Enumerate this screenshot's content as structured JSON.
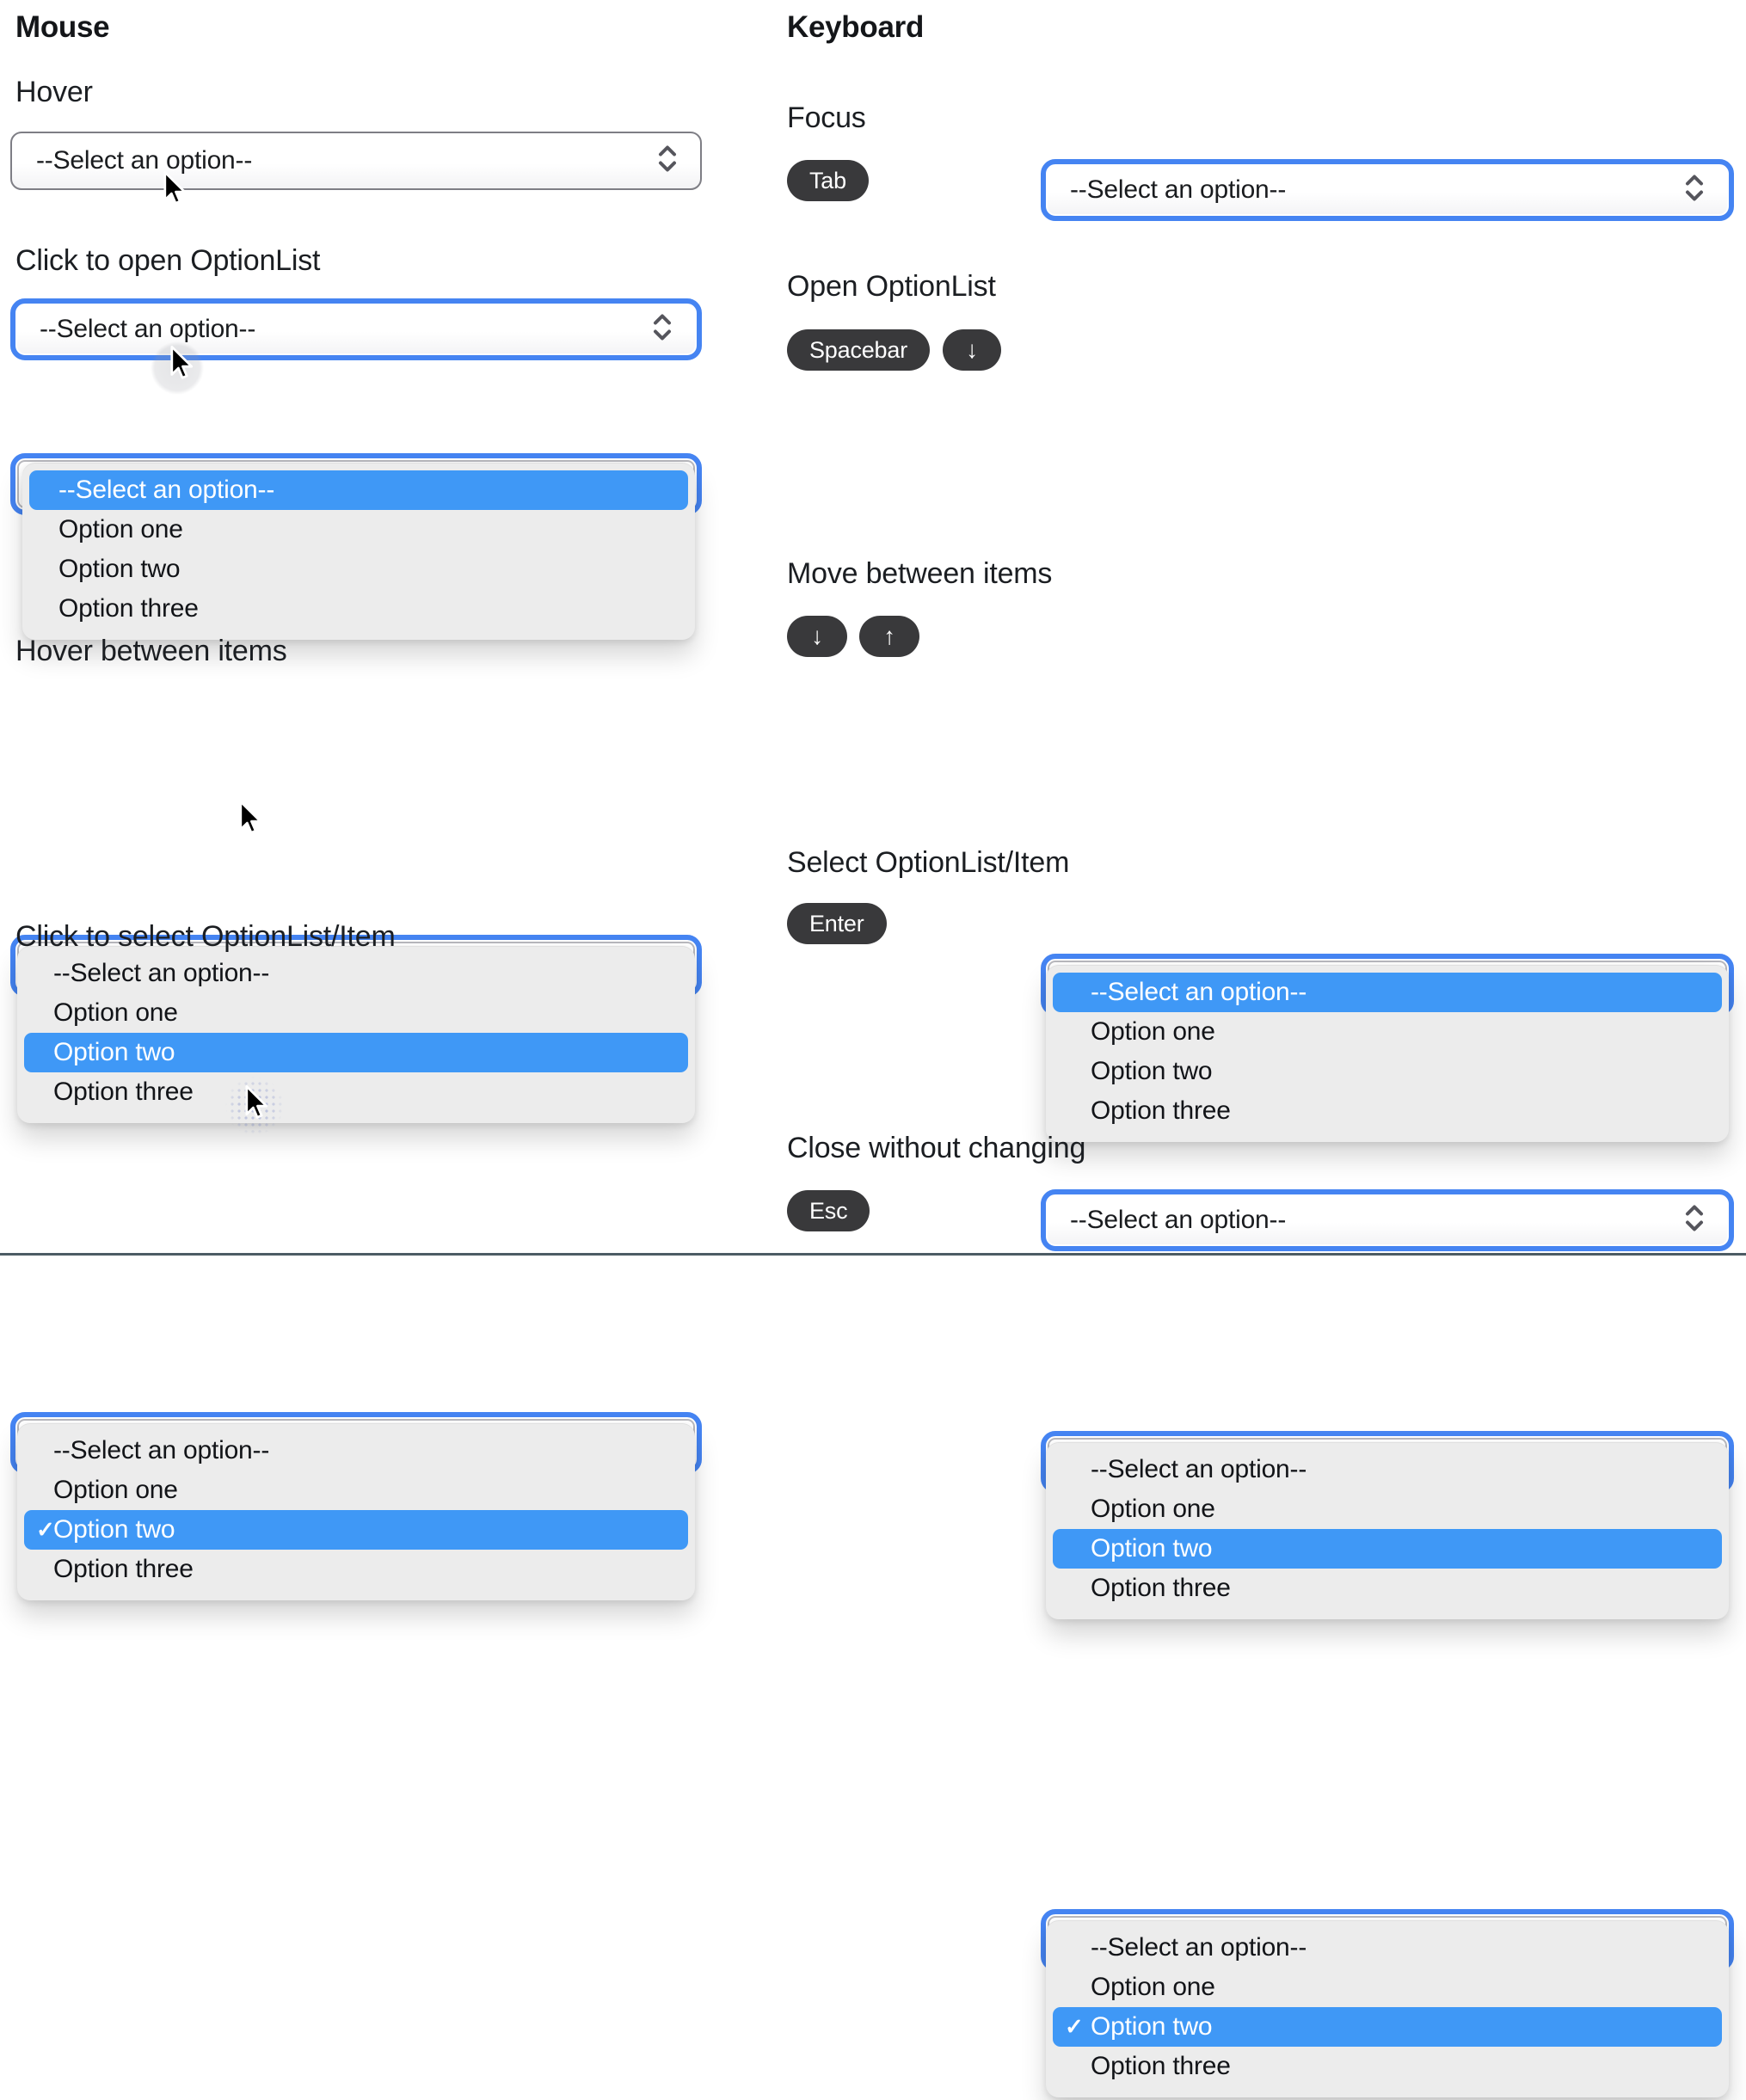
{
  "titles": {
    "mouse": "Mouse",
    "keyboard": "Keyboard"
  },
  "mouse": {
    "hover_label": "Hover",
    "open_label": "Click to open OptionList",
    "hover_items_label": "Hover between items",
    "select_item_label": "Click to select OptionList/Item"
  },
  "keyboard": {
    "focus_label": "Focus",
    "open_label": "Open OptionList",
    "move_label": "Move between items",
    "select_label": "Select OptionList/Item",
    "close_label": "Close without changing"
  },
  "keys": {
    "tab": "Tab",
    "spacebar": "Spacebar",
    "down_arrow": "↓",
    "up_arrow": "↑",
    "enter": "Enter",
    "esc": "Esc"
  },
  "select": {
    "placeholder": "--Select an option--",
    "options": [
      "--Select an option--",
      "Option one",
      "Option two",
      "Option three"
    ],
    "checkmark": "✓"
  },
  "colors": {
    "highlight_blue": "#3F98F6",
    "focus_ring_blue": "#4584F2",
    "key_pill_bg": "#39393B",
    "panel_bg": "#ECECEC",
    "divider": "#4C5B64"
  }
}
